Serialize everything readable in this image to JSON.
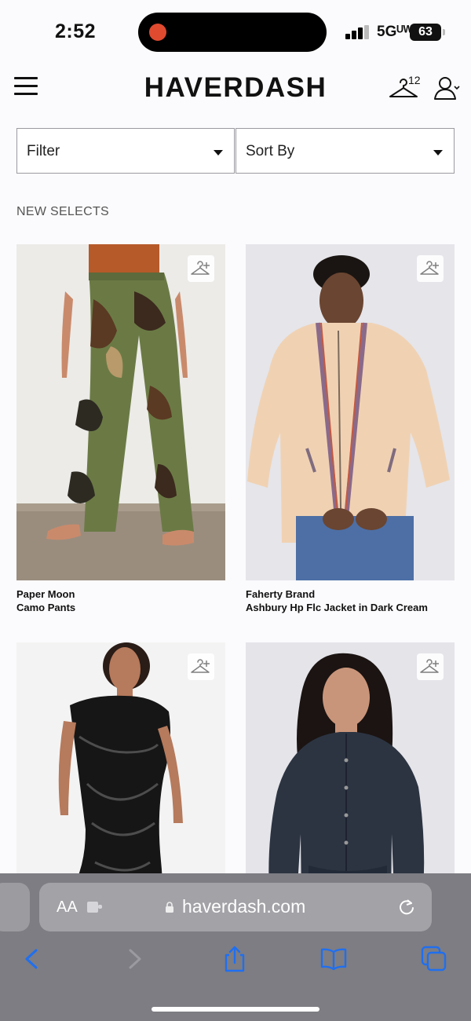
{
  "status_bar": {
    "time": "2:52",
    "network": "5Gᵁᵂ",
    "battery": "63"
  },
  "header": {
    "logo": "HAVERDASH",
    "closet_count": "12"
  },
  "controls": {
    "filter_label": "Filter",
    "sort_label": "Sort By"
  },
  "section_title": "NEW SELECTS",
  "products": [
    {
      "brand": "Paper Moon",
      "name": "Camo Pants"
    },
    {
      "brand": "Faherty Brand",
      "name": "Ashbury Hp Flc Jacket in Dark Cream"
    },
    {
      "brand": "",
      "name": ""
    },
    {
      "brand": "",
      "name": ""
    }
  ],
  "browser": {
    "text_size_label": "AA",
    "url": "haverdash.com"
  },
  "colors": {
    "accent_blue": "#1f6ff0",
    "recording_red": "#e04a2f"
  }
}
